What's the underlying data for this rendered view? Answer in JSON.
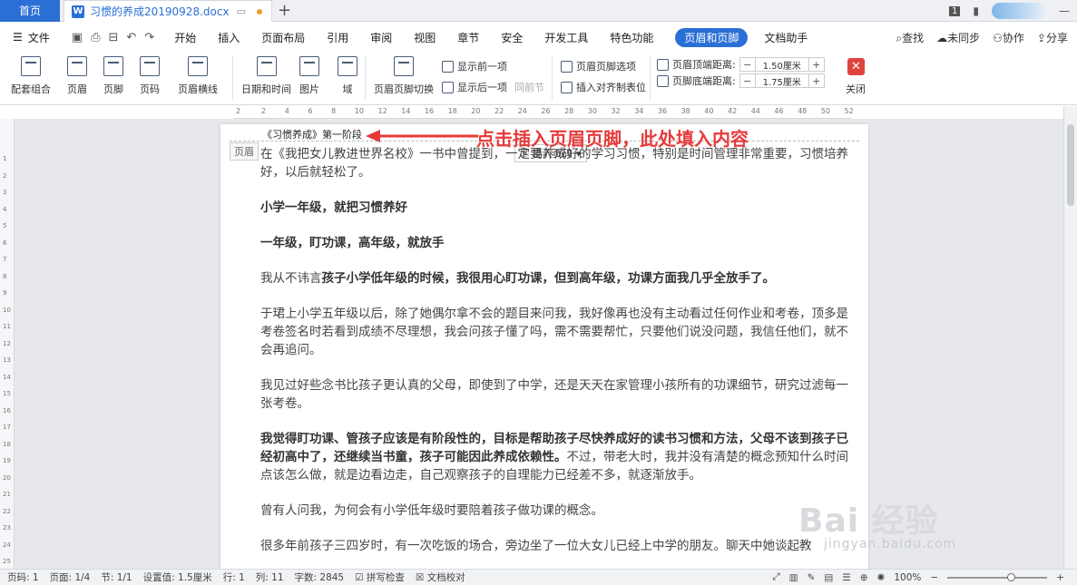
{
  "tabs": {
    "home": "首页",
    "doc": "习惯的养成20190928.docx",
    "doc_icon": "W",
    "plus": "+"
  },
  "window": {
    "badge": "1"
  },
  "menu": {
    "file": "文件",
    "items": [
      "开始",
      "插入",
      "页面布局",
      "引用",
      "审阅",
      "视图",
      "章节",
      "安全",
      "开发工具",
      "特色功能"
    ],
    "active": "页眉和页脚",
    "after": "文档助手",
    "search": "查找",
    "sync": "未同步",
    "collab": "协作",
    "share": "分享"
  },
  "ribbon": {
    "big": [
      "配套组合",
      "页眉",
      "页脚",
      "页码",
      "页眉横线",
      "日期和时间",
      "图片",
      "域",
      "页眉页脚切换"
    ],
    "show_prev": "显示前一项",
    "show_next": "显示后一项",
    "same_prev": "同前节",
    "hf_options": "页眉页脚选项",
    "insert_tab": "插入对齐制表位",
    "top_label": "页眉顶端距离:",
    "top_val": "1.50厘米",
    "bot_label": "页脚底端距离:",
    "bot_val": "1.75厘米",
    "close": "关闭"
  },
  "ruler": {
    "h": [
      "2",
      "2",
      "4",
      "6",
      "8",
      "10",
      "12",
      "14",
      "16",
      "18",
      "20",
      "22",
      "24",
      "26",
      "28",
      "30",
      "32",
      "34",
      "36",
      "38",
      "40",
      "42",
      "44",
      "46",
      "48",
      "50",
      "52"
    ],
    "v": [
      "1",
      "2",
      "3",
      "4",
      "5",
      "6",
      "7",
      "8",
      "9",
      "10",
      "11",
      "12",
      "13",
      "14",
      "15",
      "16",
      "17",
      "18",
      "19",
      "20",
      "21",
      "22",
      "23",
      "24",
      "25"
    ]
  },
  "doc": {
    "header_text": "《习惯养成》第一阶段",
    "header_tag": "页眉",
    "insert_pill": "插入页码",
    "annotation": "点击插入页眉页脚，此处填入内容",
    "p1": "在《我把女儿教进世界名校》一书中曾提到，一定要养成好的学习习惯，特别是时间管理非常重要，习惯培养好，以后就轻松了。",
    "h1": "小学一年级，就把习惯养好",
    "h2": "一年级，盯功课，高年级，就放手",
    "p2a": "我从不讳言",
    "p2b": "孩子小学低年级的时候，我很用心盯功课，但到高年级，功课方面我几乎全放手了。",
    "p3": "于珺上小学五年级以后，除了她偶尔拿不会的题目来问我，我好像再也没有主动看过任何作业和考卷，顶多是考卷签名时若看到成绩不尽理想，我会问孩子懂了吗，需不需要帮忙，只要他们说没问题，我信任他们，就不会再追问。",
    "p4": "我见过好些念书比孩子更认真的父母，即使到了中学，还是天天在家管理小孩所有的功课细节，研究过滤每一张考卷。",
    "p5a": "我觉得盯功课、管孩子应该是有阶段性的，目标是帮助孩子尽快养成好的读书习惯和方法，父母不该到孩子已经初高中了，还继续当书童，孩子可能因此养成依赖性。",
    "p5b": "不过，带老大时，我并没有清楚的概念预知什么时间点该怎么做，就是边看边走，自己观察孩子的自理能力已经差不多，就逐渐放手。",
    "p6": "曾有人问我，为何会有小学低年级时要陪着孩子做功课的概念。",
    "p7": "很多年前孩子三四岁时，有一次吃饭的场合，旁边坐了一位大女儿已经上中学的朋友。聊天中她谈起教"
  },
  "watermark": {
    "main": "Bai 经验",
    "url": "jingyan.baidu.com"
  },
  "status": {
    "page_code": "页码: 1",
    "page": "页面: 1/4",
    "section": "节: 1/1",
    "setting": "设置值: 1.5厘米",
    "row": "行: 1",
    "col": "列: 11",
    "words": "字数: 2845",
    "spell": "拼写检查",
    "proof": "文档校对",
    "zoom": "100%"
  }
}
